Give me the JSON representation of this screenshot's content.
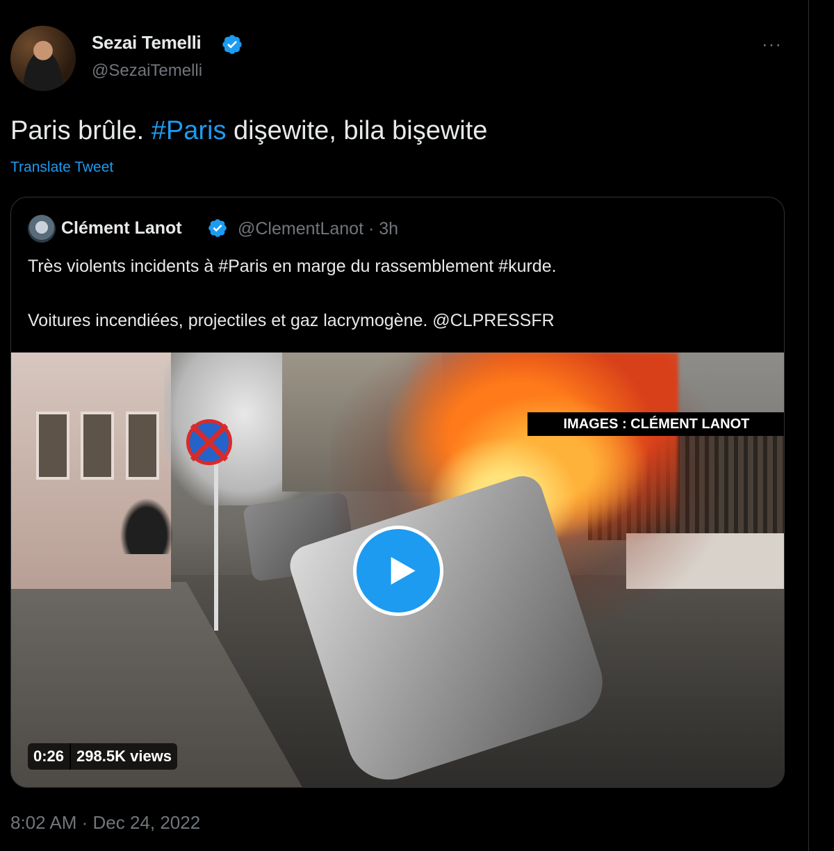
{
  "author": {
    "name": "Sezai Temelli",
    "handle": "@SezaiTemelli",
    "verified": true
  },
  "tweet": {
    "text_before": "Paris brûle. ",
    "hashtag": "#Paris",
    "text_after": " dişewite, bila bişewite",
    "translate_label": "Translate Tweet",
    "timestamp": "8:02 AM · Dec 24, 2022"
  },
  "quoted": {
    "name": "Clément Lanot",
    "handle_time": "@ClementLanot · 3h",
    "verified": true,
    "line1": "Très violents incidents à #Paris en marge du rassemblement #kurde.",
    "line2": "Voitures incendiées, projectiles et gaz lacrymogène. @CLPRESSFR"
  },
  "video": {
    "watermark": "IMAGES : CLÉMENT LANOT",
    "duration": "0:26",
    "views": "298.5K views"
  },
  "menu": {
    "more_label": "···"
  },
  "colors": {
    "background": "#000000",
    "link": "#1d9bf0",
    "text": "#e7e9ea",
    "muted": "#71767b"
  },
  "icons": [
    "verified-badge-icon",
    "more-options-icon",
    "play-icon"
  ]
}
